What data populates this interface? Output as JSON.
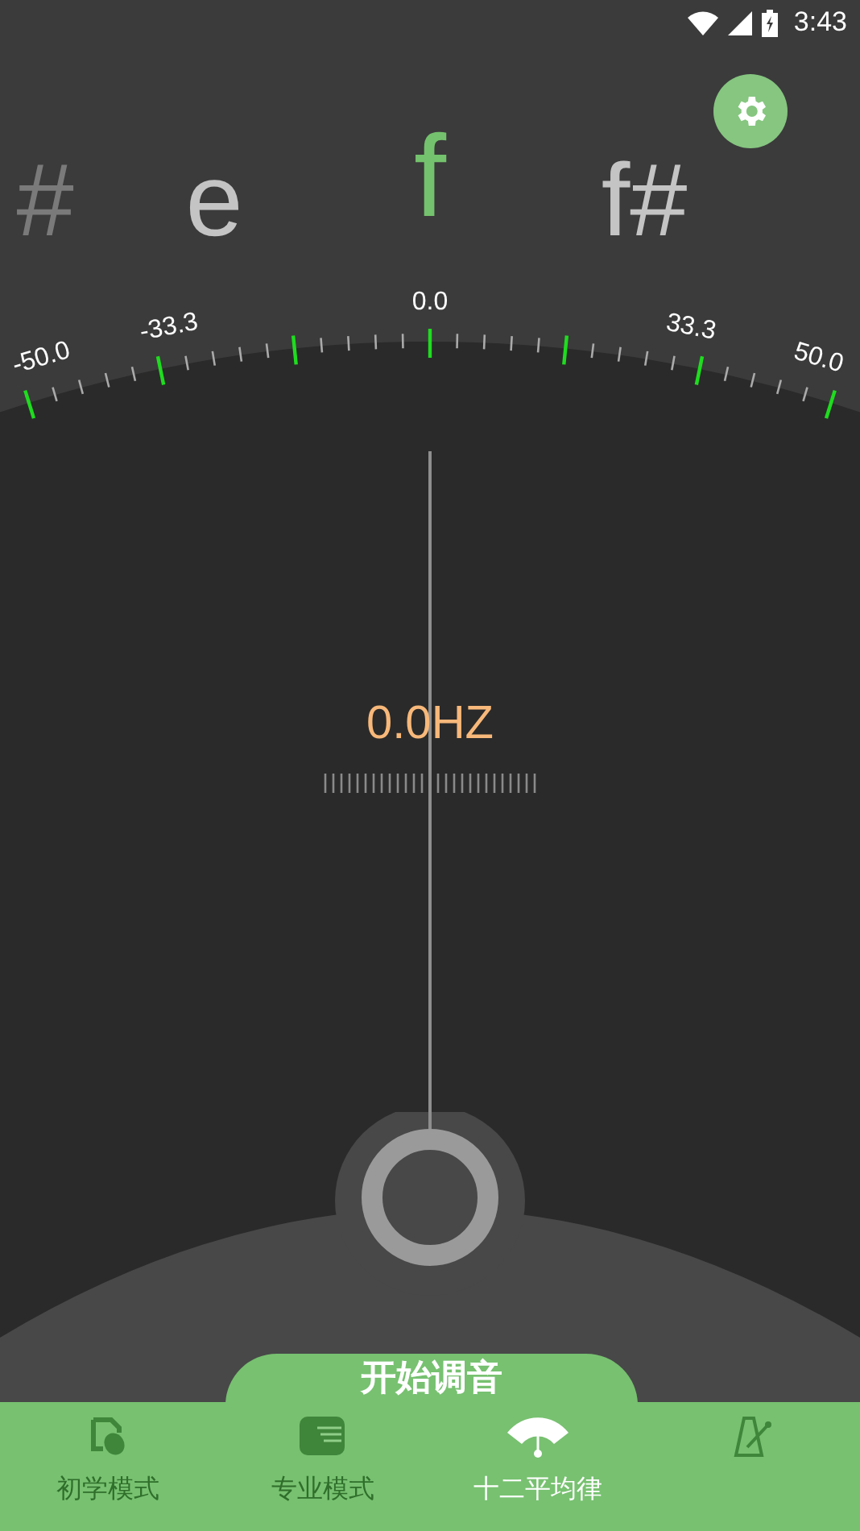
{
  "status_bar": {
    "time": "3:43"
  },
  "notes": [
    {
      "label": "#",
      "selected": false
    },
    {
      "label": "e",
      "selected": false
    },
    {
      "label": "f",
      "selected": true
    },
    {
      "label": "f#",
      "selected": false
    }
  ],
  "scale": {
    "labels": [
      "-50.0",
      "-33.3",
      "0.0",
      "33.3",
      "50.0"
    ]
  },
  "frequency": "0.0HZ",
  "start_button": "开始调音",
  "tabs": [
    {
      "kind": "beginner",
      "label": "初学模式",
      "selected": false
    },
    {
      "kind": "pro",
      "label": "专业模式",
      "selected": false
    },
    {
      "kind": "temperament",
      "label": "十二平均律",
      "selected": true
    },
    {
      "kind": "metronome",
      "selected": false
    }
  ]
}
